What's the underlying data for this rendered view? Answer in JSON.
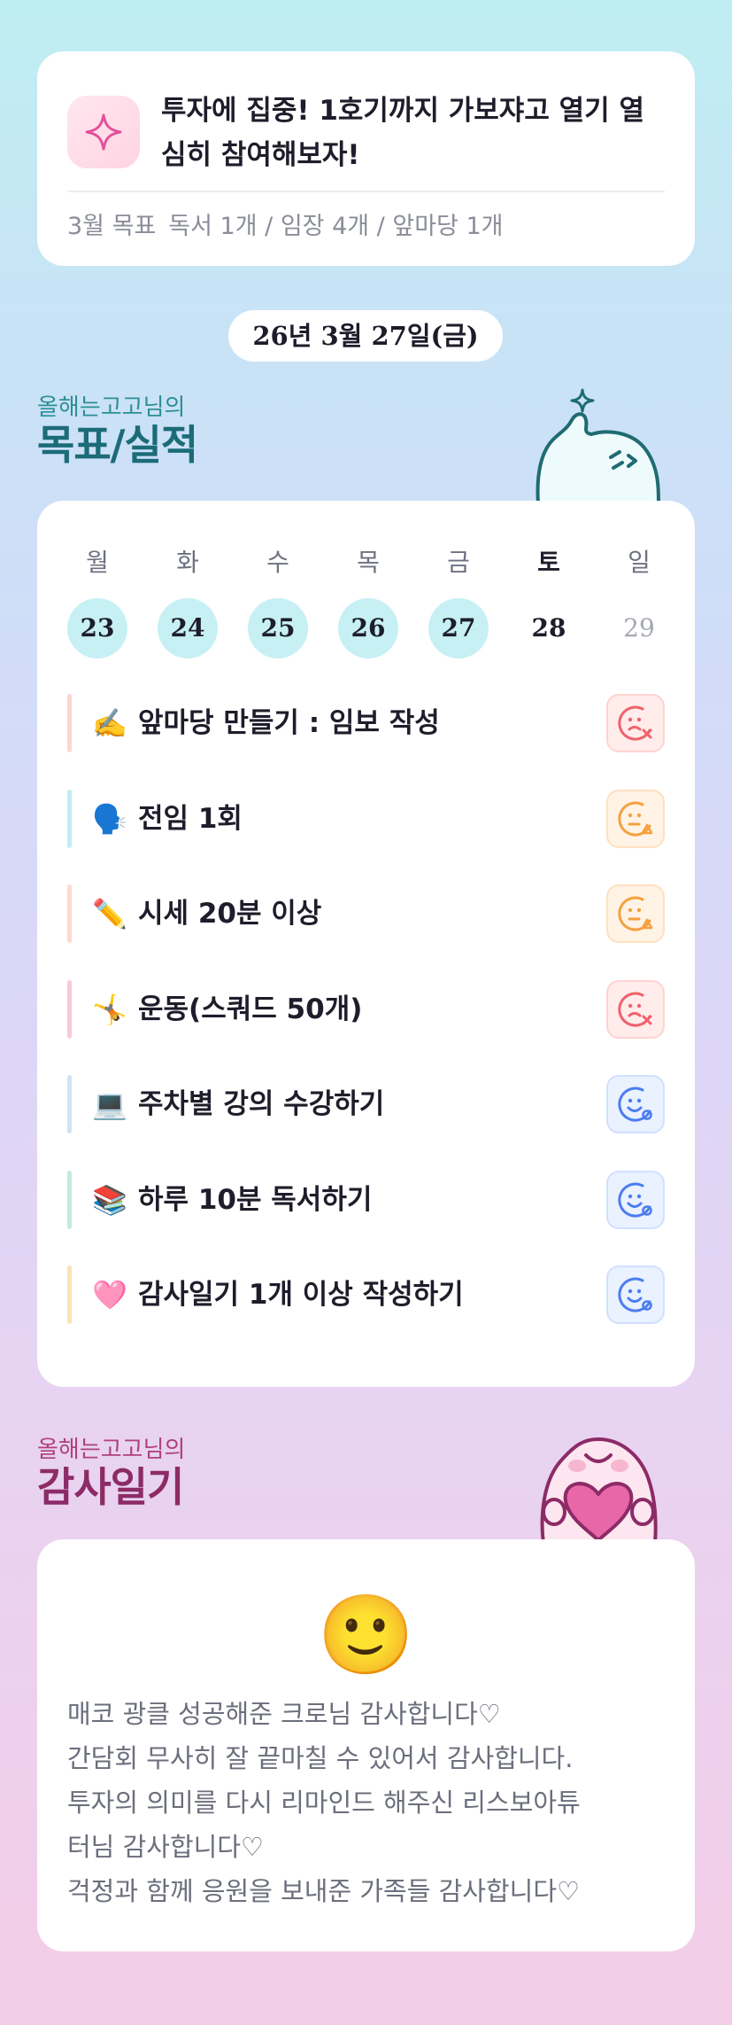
{
  "motto": {
    "icon": "sparkle-icon",
    "text_line1": "투자에 집중! 1호기까지 가보쟈고 열기 열",
    "text_line2": "심히 참여해보자!",
    "goal_label": "3월 목표",
    "goal_text": "독서 1개 / 임장 4개 / 앞마당 1개"
  },
  "date": "26년 3월 27일(금)",
  "goal_section": {
    "subtitle": "올해는고고님의",
    "title": "목표/실적"
  },
  "week": {
    "days": [
      {
        "weekday": "월",
        "date": "23",
        "state": "done"
      },
      {
        "weekday": "화",
        "date": "24",
        "state": "done"
      },
      {
        "weekday": "수",
        "date": "25",
        "state": "done"
      },
      {
        "weekday": "목",
        "date": "26",
        "state": "done"
      },
      {
        "weekday": "금",
        "date": "27",
        "state": "done"
      },
      {
        "weekday": "토",
        "date": "28",
        "state": "current"
      },
      {
        "weekday": "일",
        "date": "29",
        "state": "future"
      }
    ]
  },
  "tasks": [
    {
      "emoji": "✍️",
      "label": "앞마당 만들기 : 임보 작성",
      "status": "bad",
      "bar_color": "#ffd4d2"
    },
    {
      "emoji": "🗣️",
      "label": "전임 1회",
      "status": "meh",
      "bar_color": "#bfeef2"
    },
    {
      "emoji": "✏️",
      "label": "시세 20분 이상",
      "status": "meh",
      "bar_color": "#ffd9d0"
    },
    {
      "emoji": "🤸",
      "label": "운동(스쿼드 50개)",
      "status": "bad",
      "bar_color": "#f8c9dd"
    },
    {
      "emoji": "💻",
      "label": "주차별 강의 수강하기",
      "status": "good",
      "bar_color": "#cfe4f5"
    },
    {
      "emoji": "📚",
      "label": "하루 10분 독서하기",
      "status": "good",
      "bar_color": "#c3ece0"
    },
    {
      "emoji": "🩷",
      "label": "감사일기 1개 이상 작성하기",
      "status": "good",
      "bar_color": "#fbe3b8"
    }
  ],
  "gratitude_section": {
    "subtitle": "올해는고고님의",
    "title": "감사일기"
  },
  "gratitude": {
    "emoji": "🙂",
    "lines": [
      "매코 광클 성공해준 크로님 감사합니다♡",
      "간담회 무사히 잘 끝마칠 수 있어서 감사합니다.",
      "투자의 의미를 다시 리마인드 해주신 리스보아튜",
      "터님 감사합니다♡",
      "걱정과 함께 응원을 보내준 가족들 감사합니다♡"
    ]
  },
  "colors": {
    "bad": "#f0616b",
    "meh": "#f5a13d",
    "good": "#4c7df0",
    "done_day": "#c7f0f4"
  }
}
